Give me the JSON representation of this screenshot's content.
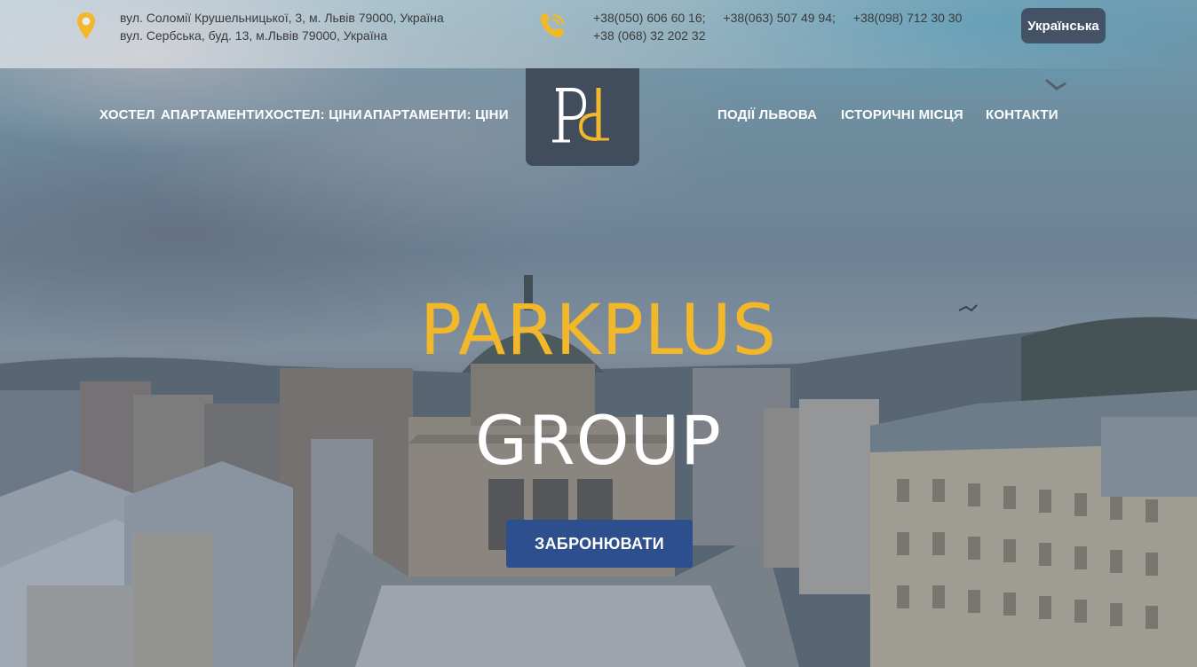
{
  "topbar": {
    "address_lines": [
      "вул. Соломії Крушельницької, 3, м. Львів 79000, Україна",
      "вул. Сербська, буд. 13, м.Львів 79000, Україна"
    ],
    "phones_line1": [
      "+38(050) 606 60 16;",
      "+38(063) 507 49 94;",
      "+38(098) 712 30 30"
    ],
    "phones_line2": "+38 (068) 32 202 32",
    "language": "Українська",
    "icons": {
      "address": "map-pin-icon",
      "phone": "phone-ringing-icon"
    },
    "accent": "#f2b82a"
  },
  "nav": {
    "left": [
      "ХОСТЕЛ",
      "АПАРТАМЕНТИ",
      "ХОСТЕЛ: ЦІНИ",
      "АПАРТАМЕНТИ: ЦІНИ"
    ],
    "right": [
      "ПОДІЇ ЛЬВОВА",
      "ІСТОРИЧНІ МІСЦЯ",
      "КОНТАКТИ"
    ],
    "logo_text": "Pd"
  },
  "hero": {
    "title_line1": "PARKPLUS",
    "title_line2": "GROUP",
    "cta": "ЗАБРОНЮВАТИ",
    "colors": {
      "title": "#f2b82a",
      "button": "#2d4f8e"
    }
  }
}
